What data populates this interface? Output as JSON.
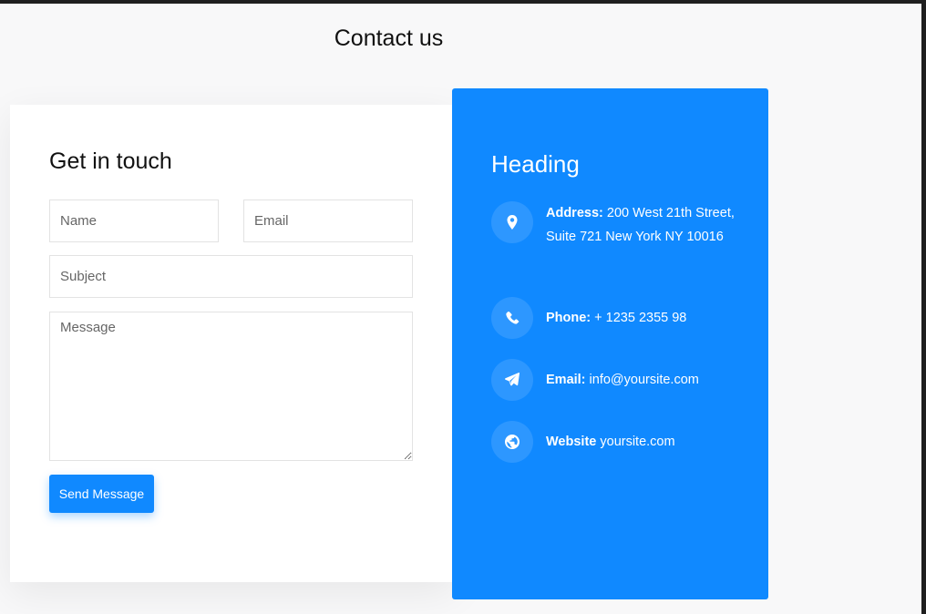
{
  "page": {
    "title": "Contact us"
  },
  "form": {
    "heading": "Get in touch",
    "name_placeholder": "Name",
    "email_placeholder": "Email",
    "subject_placeholder": "Subject",
    "message_placeholder": "Message",
    "submit_label": "Send Message"
  },
  "info": {
    "heading": "Heading",
    "items": [
      {
        "icon": "map-marker-icon",
        "label": "Address:",
        "value": "200 West 21th Street, Suite 721 New York NY 10016"
      },
      {
        "icon": "phone-icon",
        "label": "Phone:",
        "value": "+ 1235 2355 98"
      },
      {
        "icon": "paper-plane-icon",
        "label": "Email:",
        "value": "info@yoursite.com"
      },
      {
        "icon": "globe-icon",
        "label": "Website",
        "value": "yoursite.com"
      }
    ]
  },
  "colors": {
    "accent": "#1089ff",
    "page_background": "#f8f8f9",
    "card_background": "#ffffff"
  }
}
